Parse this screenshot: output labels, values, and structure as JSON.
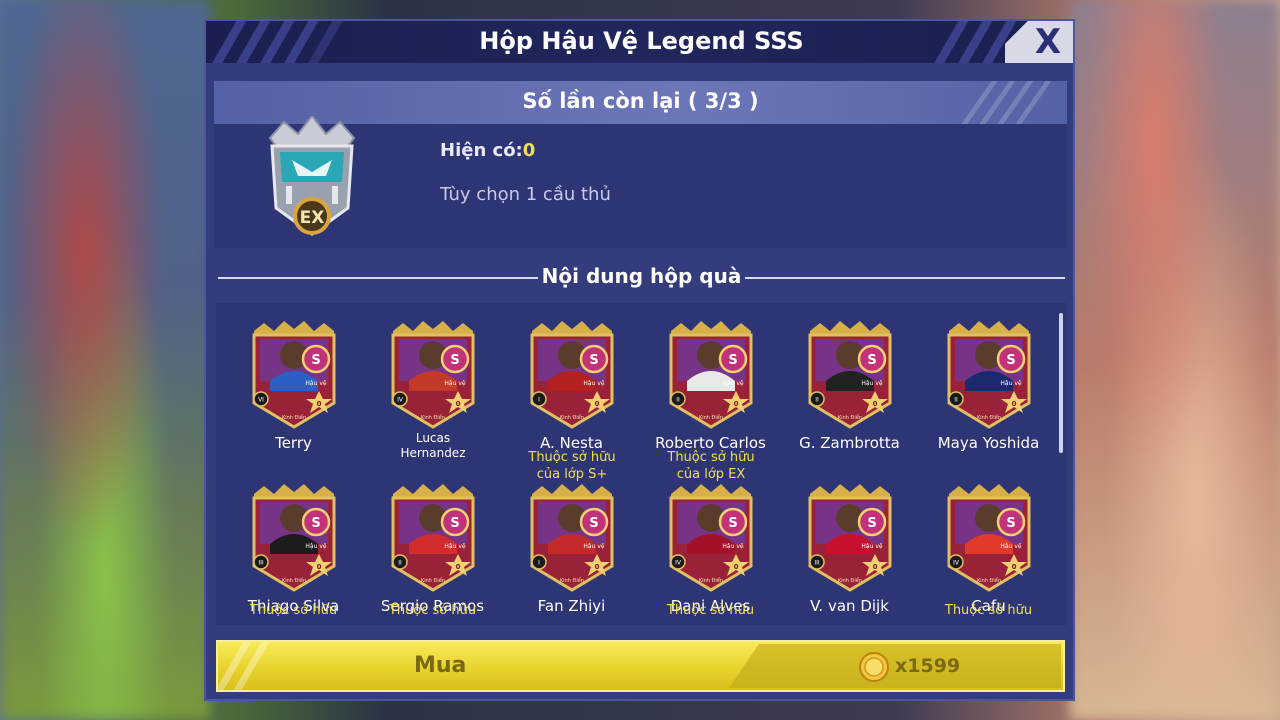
{
  "dialog": {
    "title": "Hộp Hậu Vệ Legend SSS",
    "close_label": "X"
  },
  "info": {
    "header": "Số lần còn lại ( 3/3 )",
    "owned_label": "Hiện có:",
    "owned_count": "0",
    "option_text": "Tùy chọn 1 cầu thủ",
    "badge_text": "EX"
  },
  "contents": {
    "section_title": "Nội dung hộp quà",
    "players": [
      {
        "name": "Terry",
        "note": "",
        "kit": "#2a5fc4",
        "rank": "VI"
      },
      {
        "name": "Lucas Hernandez",
        "note": "",
        "kit": "#c43a2a",
        "rank": "IV"
      },
      {
        "name": "A. Nesta",
        "note": "Thuộc sở hữu của lớp S+",
        "kit": "#b22020",
        "rank": "I"
      },
      {
        "name": "Roberto Carlos",
        "note": "Thuộc sở hữu của lớp EX",
        "kit": "#e8e8e8",
        "rank": "II"
      },
      {
        "name": "G. Zambrotta",
        "note": "",
        "kit": "#222222",
        "rank": "II"
      },
      {
        "name": "Maya Yoshida",
        "note": "",
        "kit": "#1b2a6e",
        "rank": "II"
      },
      {
        "name": "Thiago Silva",
        "note": "Thuộc sở hữu",
        "kit": "#1c1c1c",
        "rank": "III"
      },
      {
        "name": "Sergio Ramos",
        "note": "Thuộc sở hữu",
        "kit": "#d22c2c",
        "rank": "II"
      },
      {
        "name": "Fan Zhiyi",
        "note": "",
        "kit": "#c42a2a",
        "rank": "I"
      },
      {
        "name": "Dani Alves",
        "note": "Thuộc sở hữu",
        "kit": "#a3122a",
        "rank": "IV"
      },
      {
        "name": "V. van Dijk",
        "note": "",
        "kit": "#c8102e",
        "rank": "III"
      },
      {
        "name": "Cafu",
        "note": "Thuộc sở hữu",
        "kit": "#e23a2a",
        "rank": "IV"
      }
    ],
    "card_position": "Hậu vệ",
    "card_tag": "Kinh Điển",
    "card_level": "0",
    "card_grade": "S"
  },
  "buy": {
    "label": "Mua",
    "price": "x1599"
  },
  "colors": {
    "panel": "#343c7e",
    "accent_yellow": "#f2e04a",
    "buy_yellow": "#e8d32d"
  }
}
